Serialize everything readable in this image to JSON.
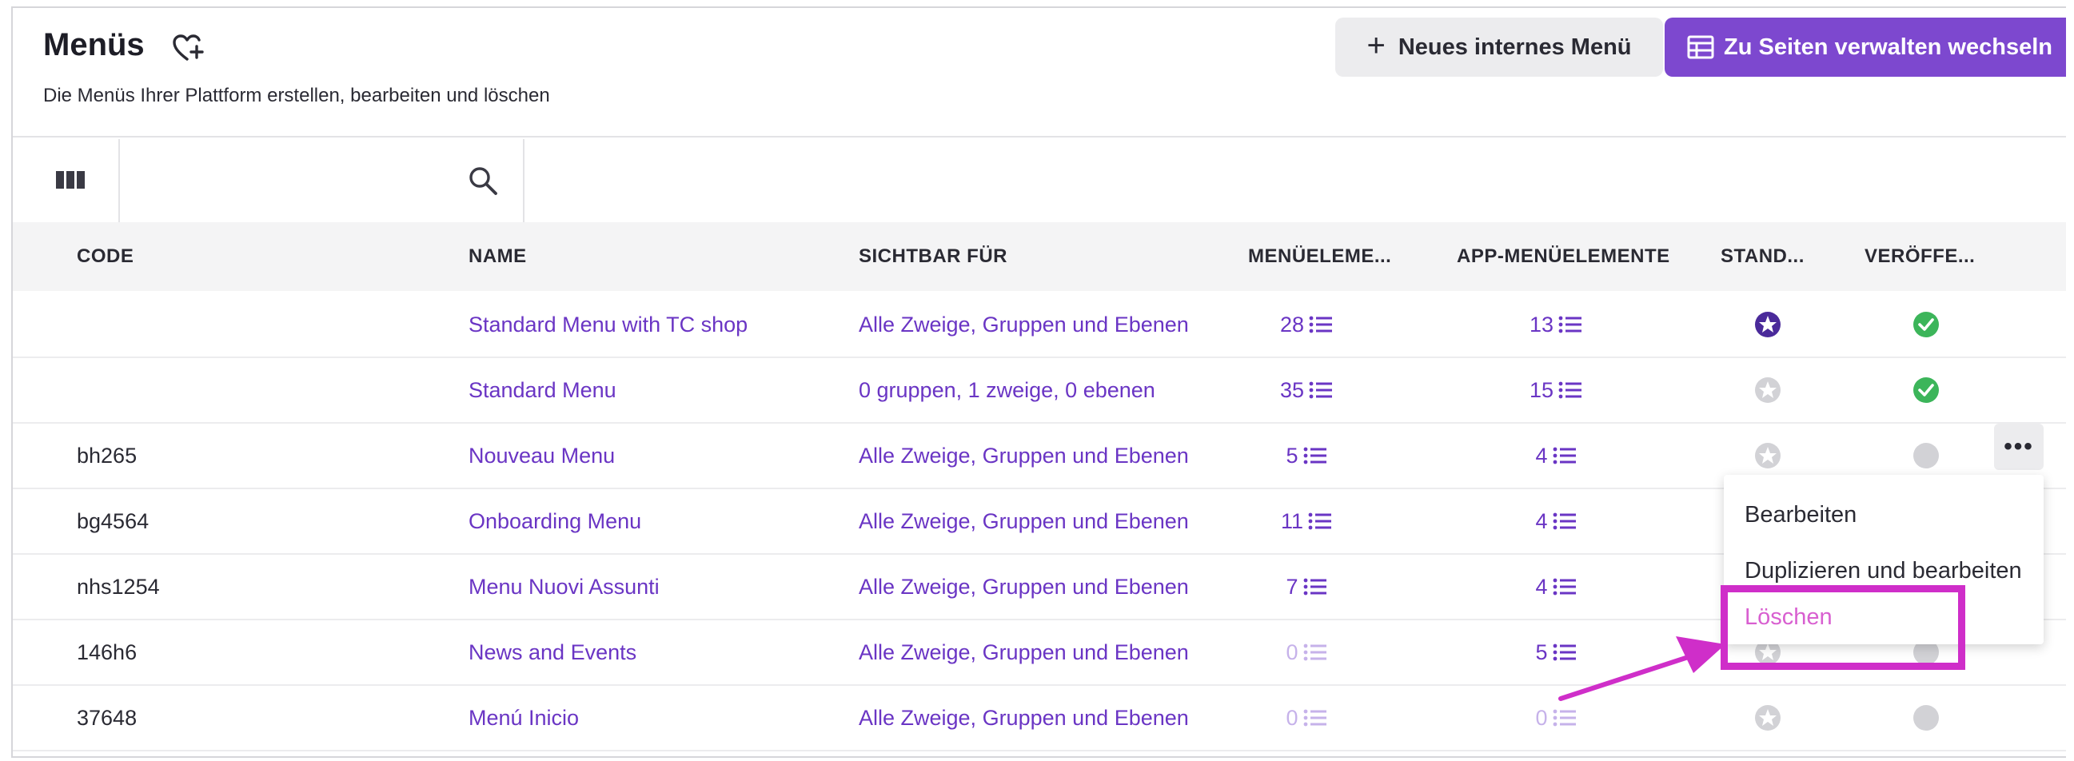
{
  "header": {
    "title": "Menüs",
    "subtitle": "Die Menüs Ihrer Plattform erstellen, bearbeiten und löschen",
    "new_menu_label": "Neues internes Menü",
    "switch_label": "Zu Seiten verwalten wechseln"
  },
  "columns": {
    "code": "CODE",
    "name": "NAME",
    "visible": "SICHTBAR FÜR",
    "menu_items": "MENÜELEME...",
    "app_items": "APP-MENÜELEMENTE",
    "standard": "STAND...",
    "published": "VERÖFFE..."
  },
  "rows": [
    {
      "code": "",
      "name": "Standard Menu with TC shop",
      "visible": "Alle Zweige, Gruppen und Ebenen",
      "menu_items": "28",
      "app_items": "13",
      "standard": "active",
      "published": "yes"
    },
    {
      "code": "",
      "name": "Standard Menu",
      "visible": "0 gruppen, 1 zweige, 0 ebenen",
      "menu_items": "35",
      "app_items": "15",
      "standard": "inactive",
      "published": "yes"
    },
    {
      "code": "bh265",
      "name": "Nouveau Menu",
      "visible": "Alle Zweige, Gruppen und Ebenen",
      "menu_items": "5",
      "app_items": "4",
      "standard": "inactive",
      "published": "no"
    },
    {
      "code": "bg4564",
      "name": "Onboarding Menu",
      "visible": "Alle Zweige, Gruppen und Ebenen",
      "menu_items": "11",
      "app_items": "4",
      "standard": "inactive",
      "published": "no"
    },
    {
      "code": "nhs1254",
      "name": "Menu Nuovi Assunti",
      "visible": "Alle Zweige, Gruppen und Ebenen",
      "menu_items": "7",
      "app_items": "4",
      "standard": "inactive",
      "published": "no"
    },
    {
      "code": "146h6",
      "name": "News and Events",
      "visible": "Alle Zweige, Gruppen und Ebenen",
      "menu_items": "0",
      "app_items": "5",
      "standard": "inactive",
      "published": "no"
    },
    {
      "code": "37648",
      "name": "Menú Inicio",
      "visible": "Alle Zweige, Gruppen und Ebenen",
      "menu_items": "0",
      "app_items": "0",
      "standard": "inactive",
      "published": "no"
    }
  ],
  "context_menu": {
    "edit": "Bearbeiten",
    "duplicate": "Duplizieren und bearbeiten",
    "delete": "Löschen"
  },
  "more_label": "•••",
  "colors": {
    "accent": "#7d48cf",
    "link": "#6a35c4",
    "published": "#3cb55a",
    "annotation": "#cf2ec9"
  },
  "icons": {
    "favorite": "heart-plus-icon",
    "columns": "columns-icon",
    "search": "search-icon",
    "list": "list-icon",
    "standard": "star-circle-icon",
    "published": "check-circle-icon"
  }
}
